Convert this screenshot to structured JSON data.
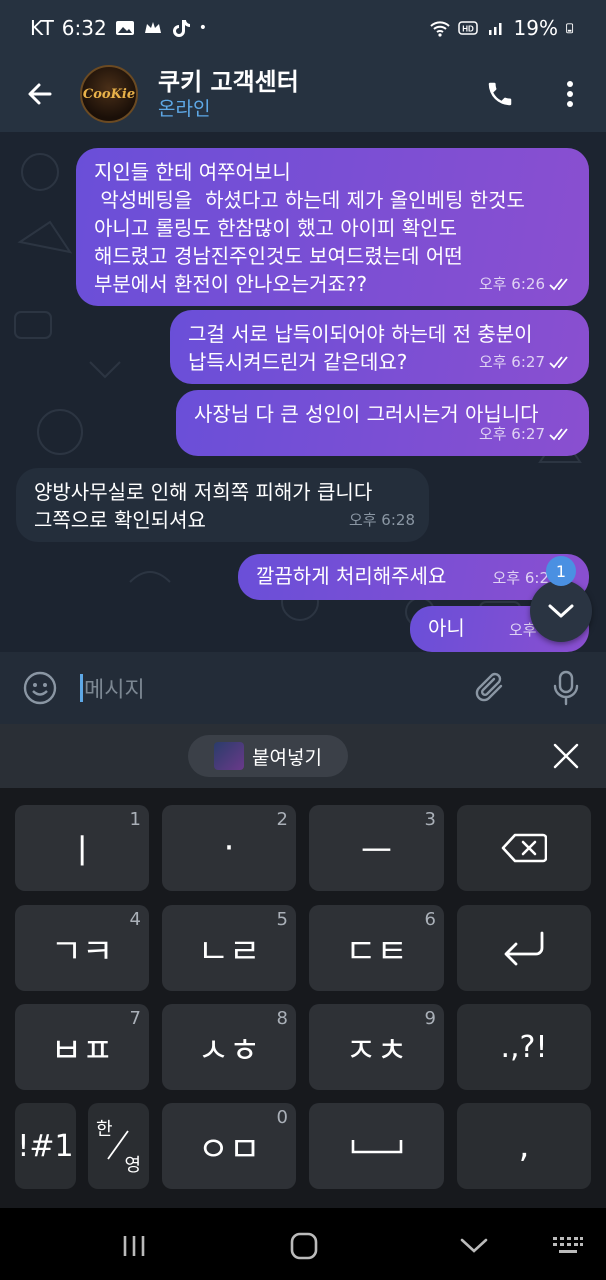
{
  "status": {
    "carrier": "KT",
    "time": "6:32",
    "dot": "•",
    "battery": "19%"
  },
  "header": {
    "title": "쿠키 고객센터",
    "subtitle": "온라인",
    "avatar_text": "CooKie"
  },
  "messages": [
    {
      "dir": "out",
      "text": [
        "지인들 한테 여쭈어보니",
        " 악성베팅을  하셨다고 하는데 제가 올인베팅 한것도",
        "아니고 롤링도 한참많이 했고 아이피 확인도",
        "해드렸고 경남진주인것도 보여드렸는데 어떤",
        "부분에서 환전이 안나오는거죠??"
      ],
      "time": "오후 6:26"
    },
    {
      "dir": "out",
      "text": [
        "그걸 서로 납득이되어야 하는데 전 충분이",
        "납득시켜드린거 같은데요?"
      ],
      "time": "오후 6:27"
    },
    {
      "dir": "out",
      "text": [
        "사장님 다 큰 성인이 그러시는거 아닙니다"
      ],
      "time": "오후 6:27"
    },
    {
      "dir": "in",
      "text": [
        "양방사무실로 인해 저희쪽 피해가 큽니다",
        "그쪽으로 확인되셔요"
      ],
      "time": "오후 6:28"
    },
    {
      "dir": "out",
      "text": [
        "깔끔하게 처리해주세요"
      ],
      "time": "오후 6:2"
    },
    {
      "dir": "out",
      "text": [
        "아니"
      ],
      "time": "오후 6:28"
    }
  ],
  "unread_badge": "1",
  "input": {
    "placeholder": "메시지"
  },
  "clipboard": {
    "paste_label": "붙여넣기"
  },
  "keys": [
    {
      "label": "ㅣ",
      "num": "1"
    },
    {
      "label": "·",
      "num": "2"
    },
    {
      "label": "ㅡ",
      "num": "3"
    },
    {
      "label": "ㄱㅋ",
      "num": "4"
    },
    {
      "label": "ㄴㄹ",
      "num": "5"
    },
    {
      "label": "ㄷㅌ",
      "num": "6"
    },
    {
      "label": "ㅂㅍ",
      "num": "7"
    },
    {
      "label": "ㅅㅎ",
      "num": "8"
    },
    {
      "label": "ㅈㅊ",
      "num": "9"
    },
    {
      "label": "ㅇㅁ",
      "num": "0"
    }
  ],
  "special_keys": {
    "punct": ".,?!",
    "symbols": "!#1",
    "lang_top": "한",
    "lang_bottom": "영",
    "comma": ","
  },
  "colors": {
    "accent": "#5ea8e6",
    "bubble_out": "#7a4fd6",
    "bubble_in": "#242e3b"
  }
}
